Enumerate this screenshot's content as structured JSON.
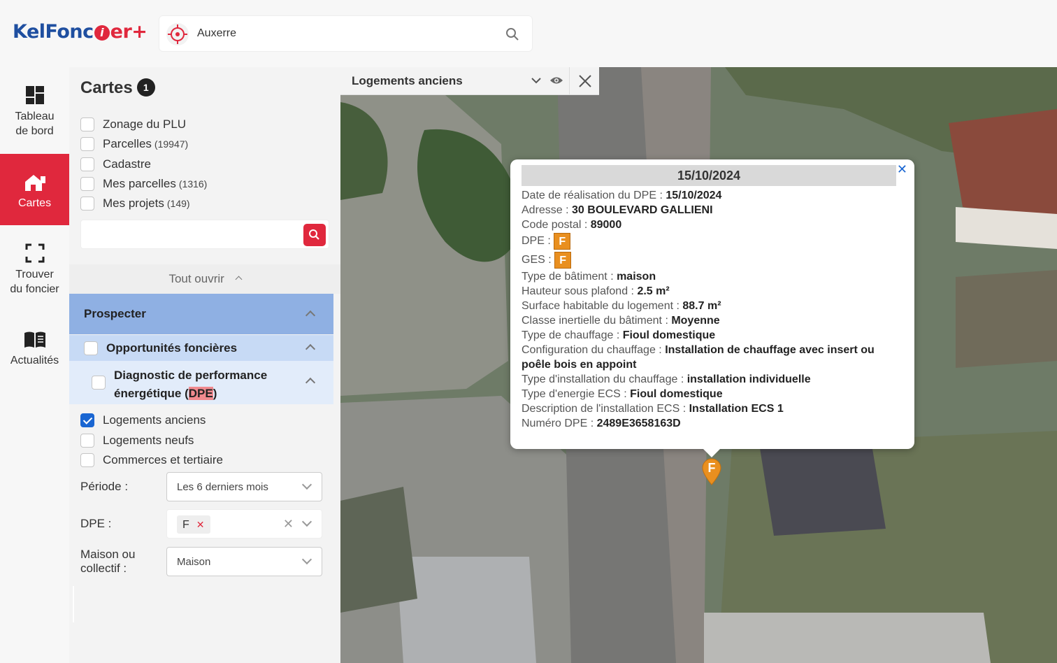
{
  "header": {
    "logo_part1": "KelFonc",
    "logo_i": "i",
    "logo_part2": "er+",
    "search_value": "Auxerre"
  },
  "rail": {
    "items": [
      {
        "label_line1": "Tableau",
        "label_line2": "de bord",
        "icon": "dashboard-icon"
      },
      {
        "label_line1": "Cartes",
        "label_line2": "",
        "icon": "home-map-icon"
      },
      {
        "label_line1": "Trouver",
        "label_line2": "du foncier",
        "icon": "focus-frame-icon"
      },
      {
        "label_line1": "Actualités",
        "label_line2": "",
        "icon": "book-icon"
      }
    ]
  },
  "panel": {
    "title": "Cartes",
    "badge": "1",
    "layers": [
      {
        "label": "Zonage du PLU",
        "count": "",
        "checked": false
      },
      {
        "label": "Parcelles",
        "count": "(19947)",
        "checked": false
      },
      {
        "label": "Cadastre",
        "count": "",
        "checked": false
      },
      {
        "label": "Mes parcelles",
        "count": "(1316)",
        "checked": false
      },
      {
        "label": "Mes projets",
        "count": "(149)",
        "checked": false
      }
    ],
    "open_all": "Tout ouvrir",
    "section_prospect": "Prospecter",
    "section_opp": "Opportunités foncières",
    "section_dpe_line1": "Diagnostic de performance",
    "section_dpe_line2_pre": "énergétique (",
    "section_dpe_line2_hl": "DPE",
    "section_dpe_line2_post": ")",
    "dpe_layers": [
      {
        "label": "Logements anciens",
        "checked": true
      },
      {
        "label": "Logements neufs",
        "checked": false
      },
      {
        "label": "Commerces et tertiaire",
        "checked": false
      }
    ],
    "periode_label": "Période :",
    "periode_value": "Les 6 derniers mois",
    "dpe_label": "DPE :",
    "dpe_tag": "F",
    "maison_label_line1": "Maison ou",
    "maison_label_line2": "collectif :",
    "maison_value": "Maison"
  },
  "map": {
    "layer_name": "Logements anciens",
    "marker_label": "F",
    "popup": {
      "title": "15/10/2024",
      "rows": [
        {
          "label": "Date de réalisation du DPE : ",
          "value": "15/10/2024"
        },
        {
          "label": "Adresse : ",
          "value": "30 BOULEVARD GALLIENI"
        },
        {
          "label": "Code postal : ",
          "value": "89000"
        },
        {
          "label": "DPE : ",
          "value": "F"
        },
        {
          "label": "GES : ",
          "value": "F"
        },
        {
          "label": "Type de bâtiment : ",
          "value": "maison"
        },
        {
          "label": "Hauteur sous plafond : ",
          "value": "2.5 m²"
        },
        {
          "label": "Surface habitable du logement : ",
          "value": "88.7 m²"
        },
        {
          "label": "Classe inertielle du bâtiment : ",
          "value": "Moyenne"
        },
        {
          "label": "Type de chauffage : ",
          "value": "Fioul domestique"
        },
        {
          "label": "Configuration du chauffage : ",
          "value": "Installation de chauffage avec insert ou poêle bois en appoint"
        },
        {
          "label": "Type d'installation du chauffage : ",
          "value": "installation individuelle"
        },
        {
          "label": "Type d'energie ECS : ",
          "value": "Fioul domestique"
        },
        {
          "label": "Description de l'installation ECS : ",
          "value": "Installation ECS 1"
        },
        {
          "label": "Numéro DPE : ",
          "value": "2489E3658163D"
        }
      ]
    }
  },
  "colors": {
    "brand_red": "#e0283d",
    "brand_blue": "#1f4fa0",
    "grade_f": "#e98f1f",
    "section_blue": "#8fb0e3"
  }
}
